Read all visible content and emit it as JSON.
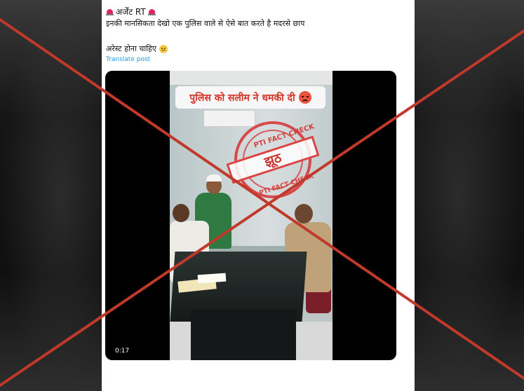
{
  "tweet": {
    "author_name": "अर्जेंट RT",
    "text_line1": "इनकी मानसिकता देखो एक पुलिस वाले से ऐसे बात करते है मदरसे छाप",
    "text_line2": "अरेस्ट होना चाहिए",
    "translate_label": "Translate post"
  },
  "video": {
    "caption": "पुलिस को सलीम ने धमकी दी",
    "duration": "0:17",
    "stamp": {
      "top_text": "PTI FACT CHECK",
      "center_text": "झूठ",
      "bottom_text": "PTI FACT CHECK"
    }
  },
  "overlay": {
    "cross_color": "#c0392b"
  }
}
